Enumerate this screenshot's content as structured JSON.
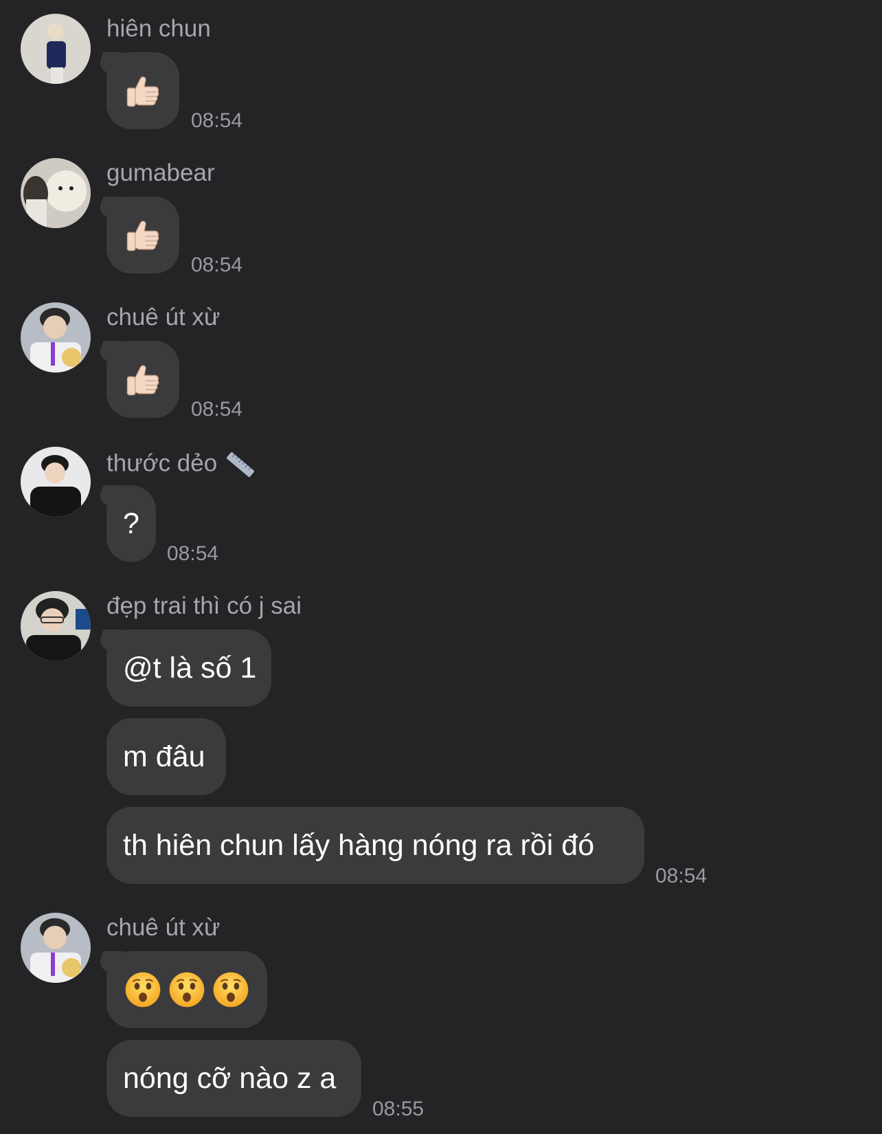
{
  "messages": [
    {
      "sender": "hiên chun",
      "avatar": "avatar-photo",
      "bubbles": [
        {
          "emoji": "thumbs-up-icon"
        }
      ],
      "time": "08:54"
    },
    {
      "sender": "gumabear",
      "avatar": "avatar-photo",
      "bubbles": [
        {
          "emoji": "thumbs-up-icon"
        }
      ],
      "time": "08:54"
    },
    {
      "sender": "chuê út xừ",
      "avatar": "avatar-photo",
      "bubbles": [
        {
          "emoji": "thumbs-up-icon"
        }
      ],
      "time": "08:54"
    },
    {
      "sender": "thước dẻo",
      "sender_icon": "ruler-icon",
      "avatar": "avatar-photo",
      "bubbles": [
        {
          "text": "?"
        }
      ],
      "time": "08:54"
    },
    {
      "sender": "đẹp trai thì có j sai",
      "avatar": "avatar-photo",
      "bubbles": [
        {
          "text": "@t là số 1"
        },
        {
          "text": "m đâu"
        },
        {
          "text": "th hiên chun lấy hàng nóng ra rồi đó"
        }
      ],
      "time": "08:54"
    },
    {
      "sender": "chuê út xừ",
      "avatar": "avatar-photo",
      "bubbles": [
        {
          "emoji": "astonished-face-icon x3"
        },
        {
          "text": "nóng cỡ nào z a"
        }
      ],
      "time": "08:55"
    }
  ],
  "colors": {
    "background": "#242426",
    "bubble": "#3b3b3d",
    "sender_name": "#a6a6ab",
    "timestamp": "#9a9a9f"
  }
}
